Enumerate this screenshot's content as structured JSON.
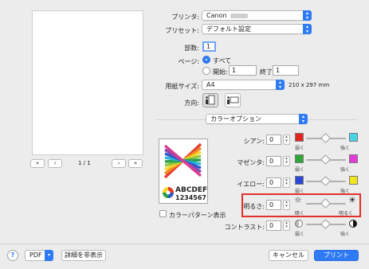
{
  "preview": {
    "page_indicator": "1 / 1",
    "nav_first": "«",
    "nav_prev": "‹",
    "nav_next": "›",
    "nav_last": "»"
  },
  "form": {
    "printer_label": "プリンタ:",
    "printer_value": "Canon",
    "preset_label": "プリセット:",
    "preset_value": "デフォルト設定",
    "copies_label": "部数:",
    "copies_value": "1",
    "pages_label": "ページ:",
    "all_label": "すべて",
    "from_label": "開始:",
    "from_value": "1",
    "to_label": "終了:",
    "to_value": "1",
    "paper_label": "用紙サイズ:",
    "paper_value": "A4",
    "paper_dims": "210 x 297 mm",
    "orientation_label": "方向:",
    "panel_value": "カラーオプション"
  },
  "thumb": {
    "line1": "ABCDEF",
    "line2": "1234567"
  },
  "color_pattern_label": "カラーパターン表示",
  "colors": {
    "cyan": {
      "label": "シアン:",
      "value": "0",
      "low": "弱く",
      "high": "強く",
      "low_color": "#e3251f",
      "high_color": "#46d3e6"
    },
    "magenta": {
      "label": "マゼンタ:",
      "value": "0",
      "low": "弱く",
      "high": "強く",
      "low_color": "#2fa63a",
      "high_color": "#e33bd8"
    },
    "yellow": {
      "label": "イエロー:",
      "value": "0",
      "low": "弱く",
      "high": "強く",
      "low_color": "#2a47d6",
      "high_color": "#f2e51b"
    },
    "brightness": {
      "label": "明るさ:",
      "value": "0",
      "low": "暗く",
      "high": "明るく"
    },
    "contrast": {
      "label": "コントラスト:",
      "value": "0",
      "low": "弱く",
      "high": "強く"
    }
  },
  "highlight_color": "#e0322a",
  "footer": {
    "help": "?",
    "pdf": "PDF",
    "details": "詳細を非表示",
    "cancel": "キャンセル",
    "print": "プリント"
  }
}
